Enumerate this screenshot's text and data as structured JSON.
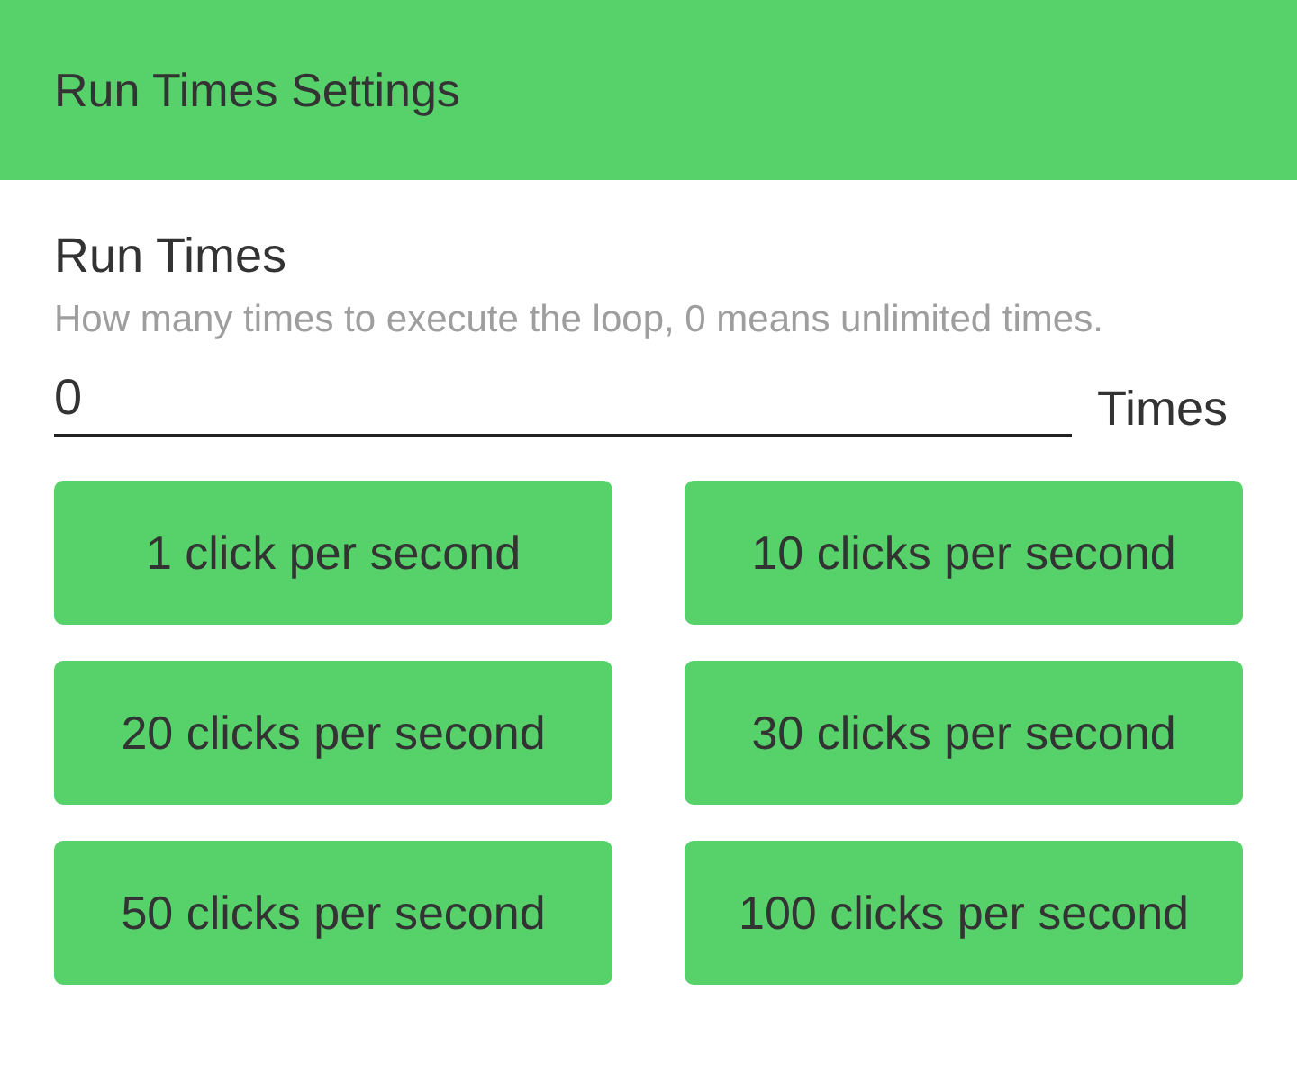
{
  "header": {
    "title": "Run Times Settings"
  },
  "setting": {
    "title": "Run Times",
    "description": "How many times to execute the loop, 0 means unlimited times.",
    "value": "0",
    "unit": "Times"
  },
  "buttons": [
    {
      "label": "1 click per second"
    },
    {
      "label": "10 clicks per second"
    },
    {
      "label": "20 clicks per second"
    },
    {
      "label": "30 clicks per second"
    },
    {
      "label": "50 clicks per second"
    },
    {
      "label": "100 clicks per second"
    }
  ]
}
